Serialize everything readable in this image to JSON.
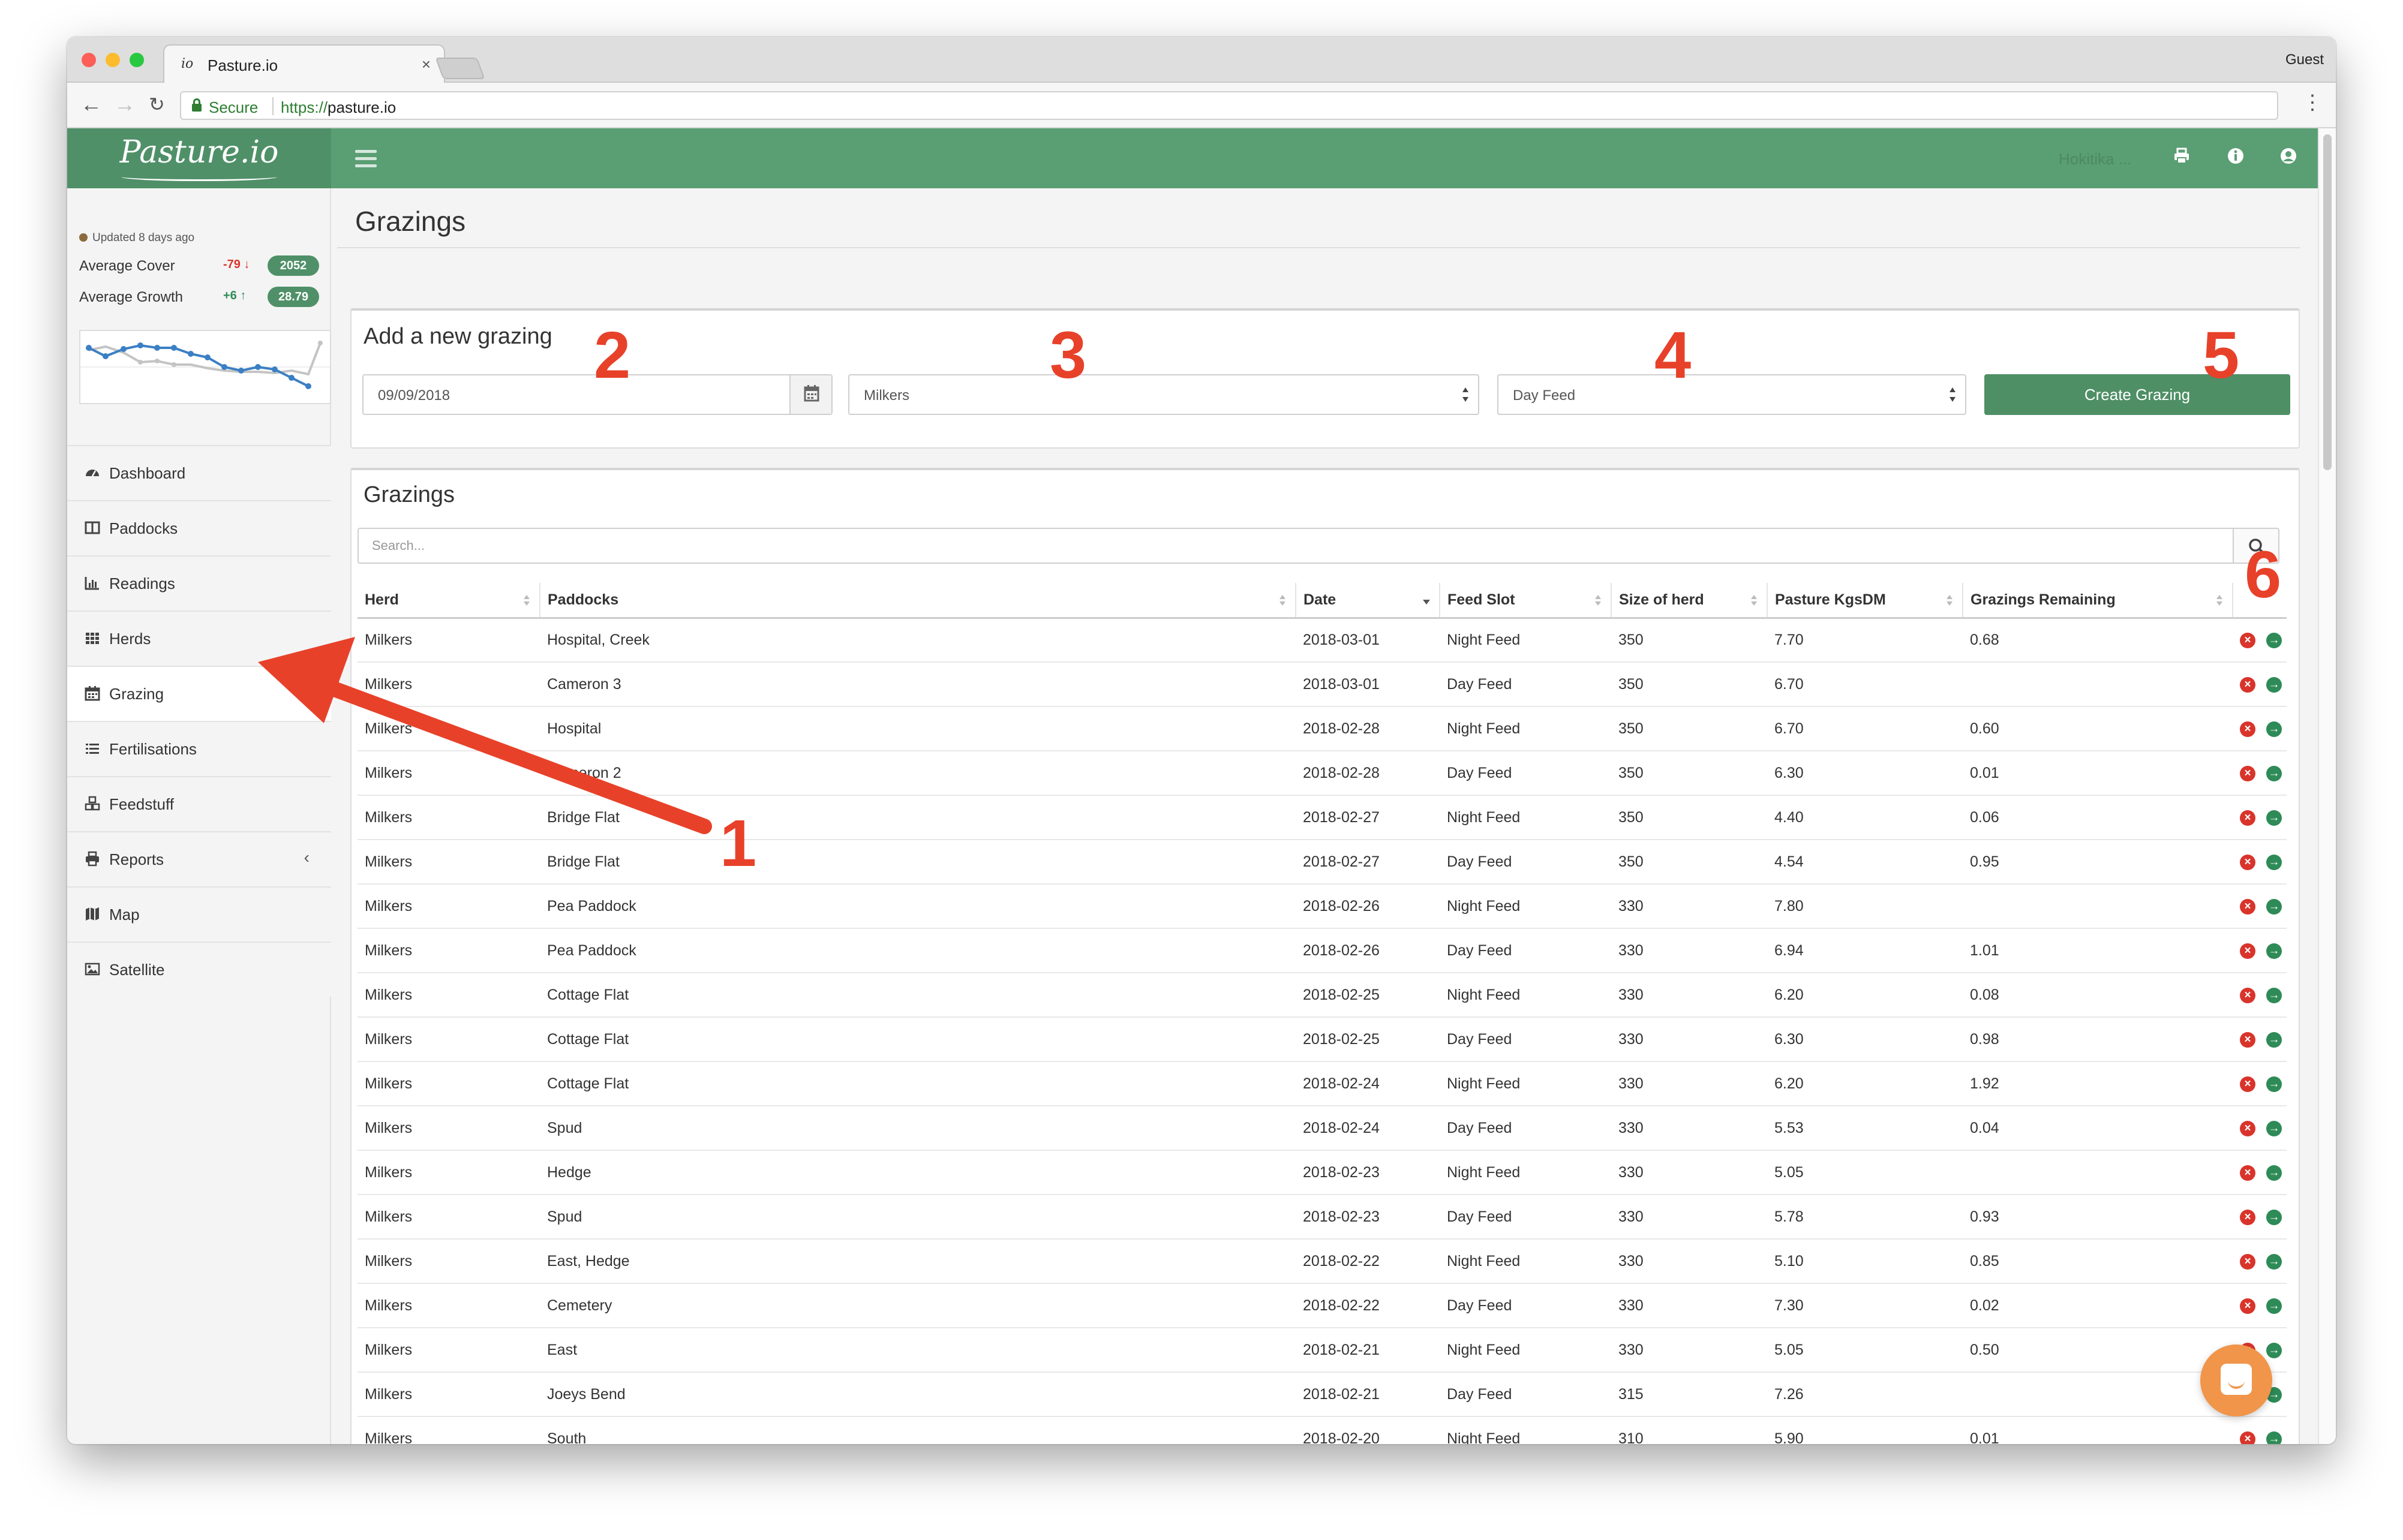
{
  "browser": {
    "tab_title": "Pasture.io",
    "tab_favicon": "io",
    "tab_close": "×",
    "profile": "Guest",
    "secure_label": "Secure",
    "url_scheme": "https://",
    "url_host": "pasture.io"
  },
  "app": {
    "logo": "Pasture.io",
    "farm_name": "Hokitika ...",
    "brand_color": "#5a9e73"
  },
  "sidebar": {
    "updated": "Updated 8 days ago",
    "metrics": [
      {
        "label": "Average Cover",
        "delta": "-79",
        "direction": "down",
        "delta_color": "#d9342b",
        "value": "2052"
      },
      {
        "label": "Average Growth",
        "delta": "+6",
        "direction": "up",
        "delta_color": "#2e8b57",
        "value": "28.79"
      }
    ],
    "nav": [
      {
        "label": "Dashboard",
        "icon": "dashboard-icon"
      },
      {
        "label": "Paddocks",
        "icon": "columns-icon"
      },
      {
        "label": "Readings",
        "icon": "bar-chart-icon"
      },
      {
        "label": "Herds",
        "icon": "grid-icon"
      },
      {
        "label": "Grazing",
        "icon": "calendar-icon",
        "active": true
      },
      {
        "label": "Fertilisations",
        "icon": "list-icon"
      },
      {
        "label": "Feedstuff",
        "icon": "cubes-icon"
      },
      {
        "label": "Reports",
        "icon": "print-icon",
        "caret": "‹"
      },
      {
        "label": "Map",
        "icon": "map-icon"
      },
      {
        "label": "Satellite",
        "icon": "image-icon"
      }
    ]
  },
  "page": {
    "title": "Grazings"
  },
  "new_grazing": {
    "title": "Add a new grazing",
    "date_value": "09/09/2018",
    "herd_value": "Milkers",
    "feed_slot_value": "Day Feed",
    "create_label": "Create Grazing"
  },
  "grazings": {
    "title": "Grazings",
    "search_placeholder": "Search...",
    "columns": [
      "Herd",
      "Paddocks",
      "Date",
      "Feed Slot",
      "Size of herd",
      "Pasture KgsDM",
      "Grazings Remaining"
    ],
    "sorted_column": "Date",
    "rows": [
      [
        "Milkers",
        "Hospital, Creek",
        "2018-03-01",
        "Night Feed",
        "350",
        "7.70",
        "0.68"
      ],
      [
        "Milkers",
        "Cameron 3",
        "2018-03-01",
        "Day Feed",
        "350",
        "6.70",
        ""
      ],
      [
        "Milkers",
        "Hospital",
        "2018-02-28",
        "Night Feed",
        "350",
        "6.70",
        "0.60"
      ],
      [
        "Milkers",
        "Cameron 2",
        "2018-02-28",
        "Day Feed",
        "350",
        "6.30",
        "0.01"
      ],
      [
        "Milkers",
        "Bridge Flat",
        "2018-02-27",
        "Night Feed",
        "350",
        "4.40",
        "0.06"
      ],
      [
        "Milkers",
        "Bridge Flat",
        "2018-02-27",
        "Day Feed",
        "350",
        "4.54",
        "0.95"
      ],
      [
        "Milkers",
        "Pea Paddock",
        "2018-02-26",
        "Night Feed",
        "330",
        "7.80",
        ""
      ],
      [
        "Milkers",
        "Pea Paddock",
        "2018-02-26",
        "Day Feed",
        "330",
        "6.94",
        "1.01"
      ],
      [
        "Milkers",
        "Cottage Flat",
        "2018-02-25",
        "Night Feed",
        "330",
        "6.20",
        "0.08"
      ],
      [
        "Milkers",
        "Cottage Flat",
        "2018-02-25",
        "Day Feed",
        "330",
        "6.30",
        "0.98"
      ],
      [
        "Milkers",
        "Cottage Flat",
        "2018-02-24",
        "Night Feed",
        "330",
        "6.20",
        "1.92"
      ],
      [
        "Milkers",
        "Spud",
        "2018-02-24",
        "Day Feed",
        "330",
        "5.53",
        "0.04"
      ],
      [
        "Milkers",
        "Hedge",
        "2018-02-23",
        "Night Feed",
        "330",
        "5.05",
        ""
      ],
      [
        "Milkers",
        "Spud",
        "2018-02-23",
        "Day Feed",
        "330",
        "5.78",
        "0.93"
      ],
      [
        "Milkers",
        "East, Hedge",
        "2018-02-22",
        "Night Feed",
        "330",
        "5.10",
        "0.85"
      ],
      [
        "Milkers",
        "Cemetery",
        "2018-02-22",
        "Day Feed",
        "330",
        "7.30",
        "0.02"
      ],
      [
        "Milkers",
        "East",
        "2018-02-21",
        "Night Feed",
        "330",
        "5.05",
        "0.50"
      ],
      [
        "Milkers",
        "Joeys Bend",
        "2018-02-21",
        "Day Feed",
        "315",
        "7.26",
        ""
      ],
      [
        "Milkers",
        "South",
        "2018-02-20",
        "Night Feed",
        "310",
        "5.90",
        "0.01"
      ]
    ],
    "row_actions": {
      "delete": "×",
      "open": "→"
    }
  },
  "annotations": [
    "1",
    "2",
    "3",
    "4",
    "5",
    "6"
  ],
  "annotation_color": "#e8412a"
}
